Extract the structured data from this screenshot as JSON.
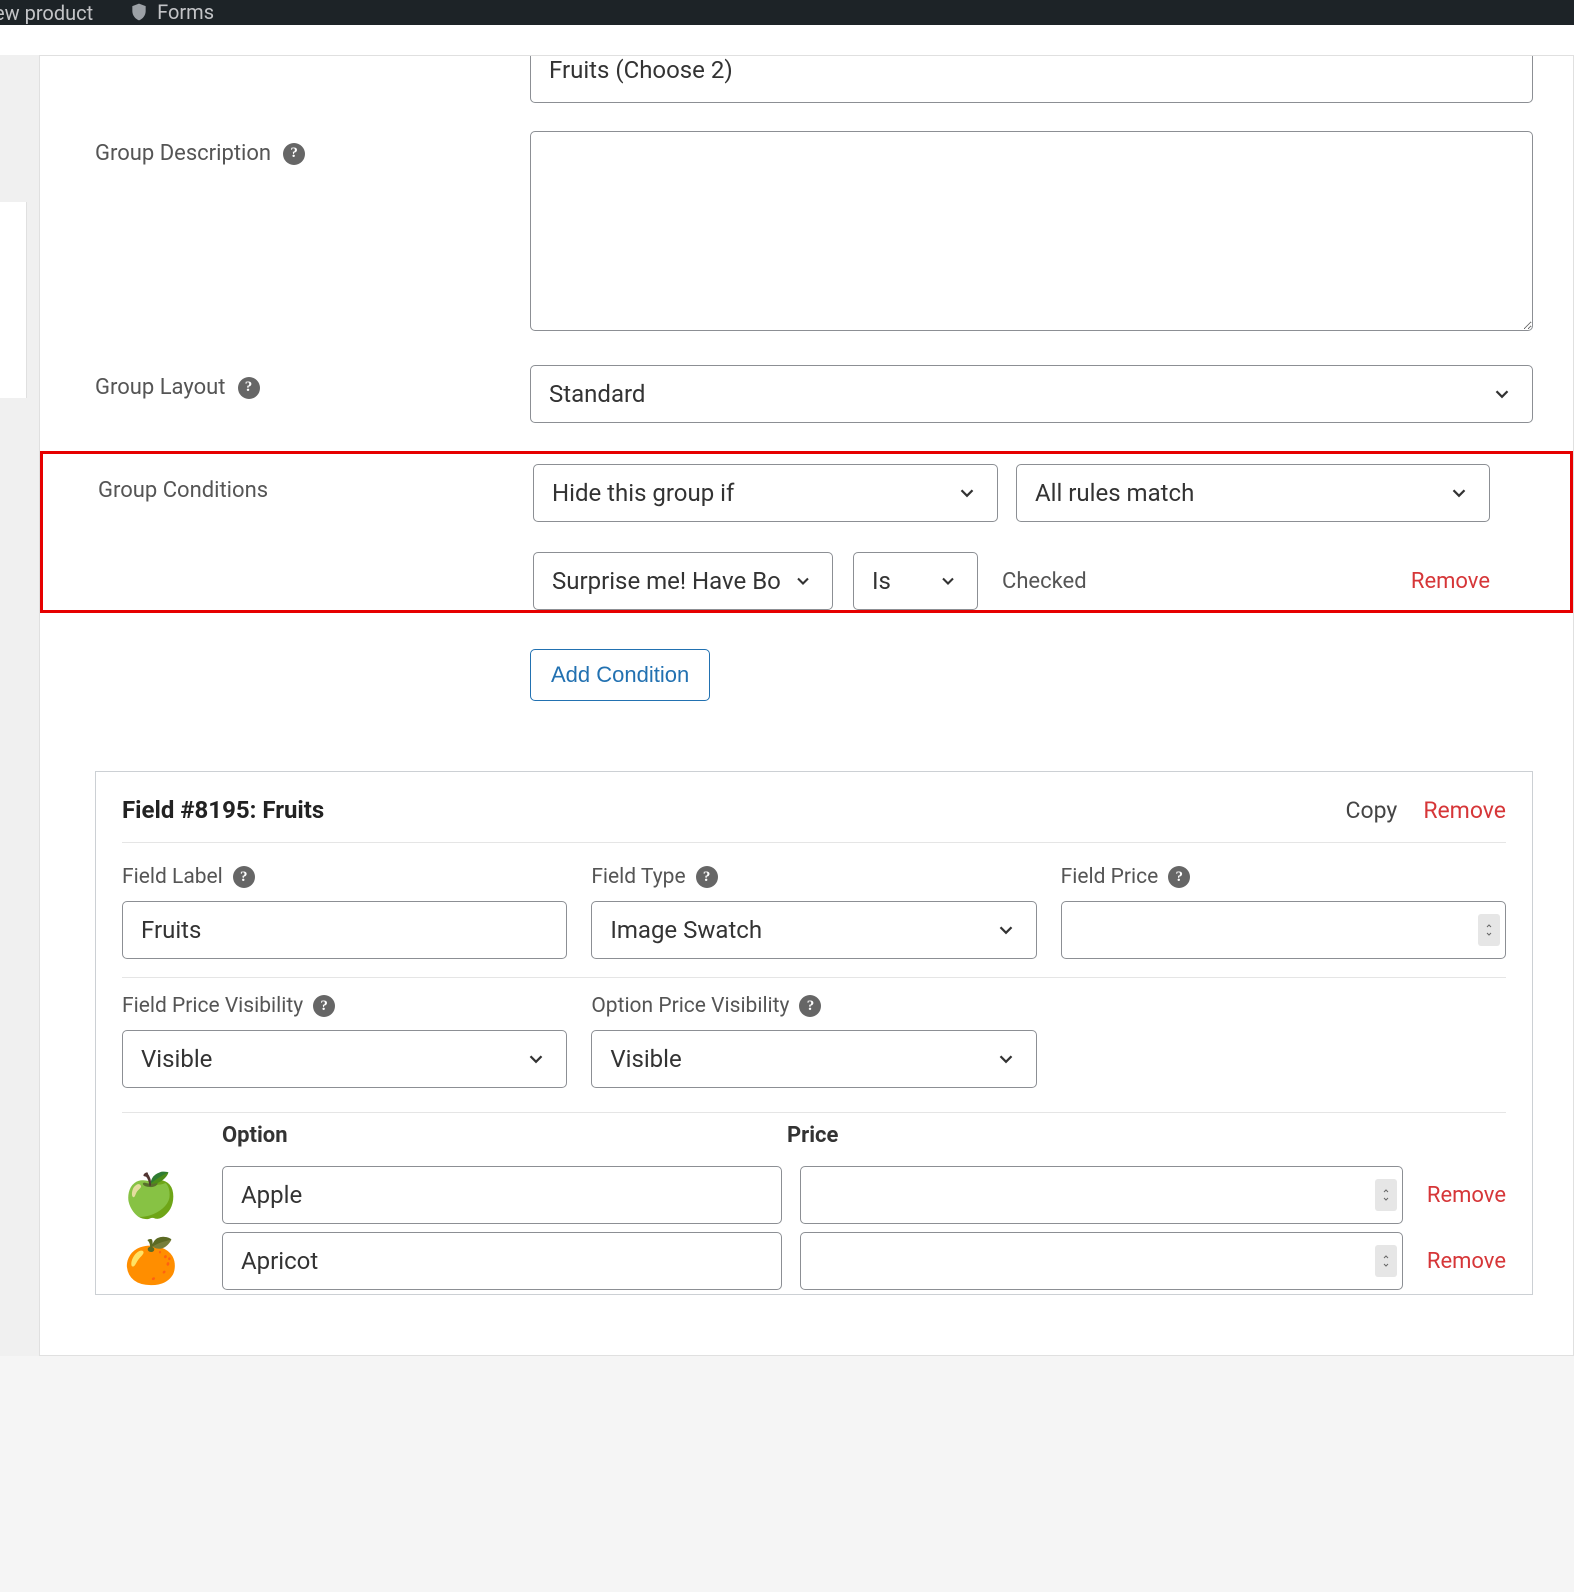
{
  "topbar": {
    "left_partial": "ew product",
    "forms": "Forms"
  },
  "group": {
    "heading_value": "Fruits (Choose 2)",
    "desc_label": "Group Description",
    "layout_label": "Group Layout",
    "layout_value": "Standard",
    "conditions_label": "Group Conditions",
    "cond_action": "Hide this group if",
    "cond_match": "All rules match",
    "cond_field": "Surprise me! Have Bo",
    "cond_op": "Is",
    "cond_value": "Checked",
    "cond_remove": "Remove",
    "add_condition": "Add Condition"
  },
  "field": {
    "title": "Field #8195: Fruits",
    "copy": "Copy",
    "remove": "Remove",
    "label_lab": "Field Label",
    "type_lab": "Field Type",
    "price_lab": "Field Price",
    "label_val": "Fruits",
    "type_val": "Image Swatch",
    "price_val": "",
    "fpv_lab": "Field Price Visibility",
    "opv_lab": "Option Price Visibility",
    "fpv_val": "Visible",
    "opv_val": "Visible",
    "opt_head_option": "Option",
    "opt_head_price": "Price",
    "options": [
      {
        "emoji": "🍏",
        "name": "Apple",
        "price": "",
        "remove": "Remove"
      },
      {
        "emoji": "🍊",
        "name": "Apricot",
        "price": "",
        "remove": "Remove"
      }
    ]
  }
}
